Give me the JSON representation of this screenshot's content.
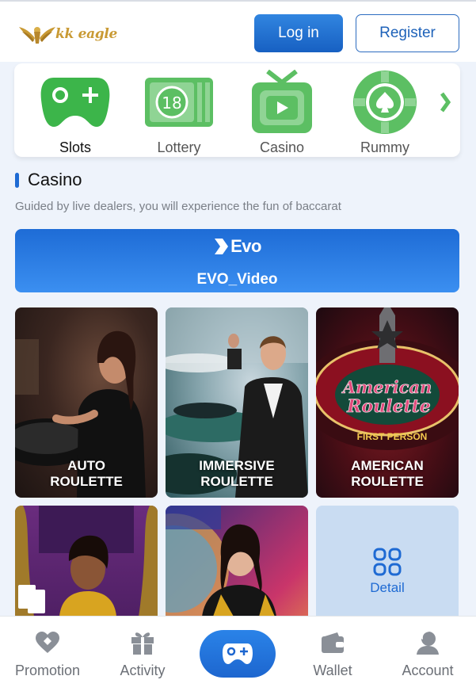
{
  "header": {
    "logo_text": "kk eagle",
    "login_label": "Log in",
    "register_label": "Register"
  },
  "categories": [
    {
      "label": "Slots",
      "icon": "gamepad-icon",
      "active": true
    },
    {
      "label": "Lottery",
      "icon": "lottery-ticket-icon",
      "active": false
    },
    {
      "label": "Casino",
      "icon": "tv-play-icon",
      "active": false
    },
    {
      "label": "Rummy",
      "icon": "poker-chip-icon",
      "active": false
    }
  ],
  "section": {
    "title": "Casino",
    "description": "Guided by live dealers, you will experience the fun of baccarat"
  },
  "provider": {
    "logo_text": "Evo",
    "name": "EVO_Video"
  },
  "games": [
    {
      "line1": "AUTO",
      "line2": "ROULETTE"
    },
    {
      "line1": "IMMERSIVE",
      "line2": "ROULETTE"
    },
    {
      "line1": "AMERICAN",
      "line2": "ROULETTE"
    }
  ],
  "game3_art": {
    "title1": "American",
    "title2": "Roulette",
    "sub": "FIRST PERSON"
  },
  "detail_label": "Detail",
  "nav": {
    "items": [
      {
        "label": "Promotion",
        "icon": "heart-diamond-icon"
      },
      {
        "label": "Activity",
        "icon": "gift-icon"
      },
      {
        "label": "Wallet",
        "icon": "wallet-icon"
      },
      {
        "label": "Account",
        "icon": "account-icon"
      }
    ],
    "center_icon": "gamepad-icon"
  },
  "colors": {
    "accent": "#1e6ad3",
    "category_green": "#3cb54a",
    "nav_icon": "#8a8f97"
  }
}
